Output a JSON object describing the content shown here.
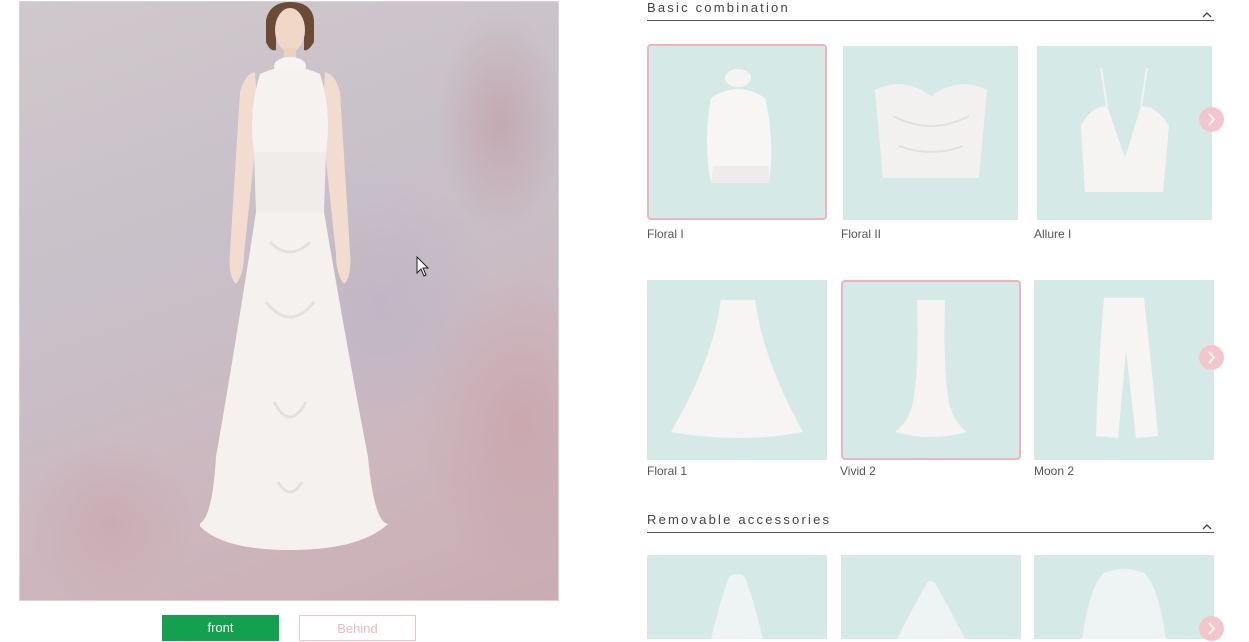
{
  "preview": {
    "front_label": "front",
    "behind_label": "Behind"
  },
  "sections": {
    "basic": {
      "title": "Basic combination"
    },
    "accessories": {
      "title": "Removable accessories"
    }
  },
  "tops": [
    {
      "label": "Floral I",
      "selected": true
    },
    {
      "label": "Floral II",
      "selected": false
    },
    {
      "label": "Allure I",
      "selected": false
    }
  ],
  "skirts": [
    {
      "label": "Floral 1",
      "selected": false
    },
    {
      "label": "Vivid 2",
      "selected": true
    },
    {
      "label": "Moon 2",
      "selected": false
    }
  ],
  "accessories": [
    {
      "label": "",
      "selected": false
    },
    {
      "label": "",
      "selected": false
    },
    {
      "label": "",
      "selected": false
    }
  ],
  "colors": {
    "accent_green": "#14a14f",
    "selection_pink": "#eeb4bb",
    "thumb_background": "#d5eae7"
  },
  "icons": [
    "chevron-up-icon",
    "chevron-right-icon",
    "mouse-cursor-icon"
  ]
}
